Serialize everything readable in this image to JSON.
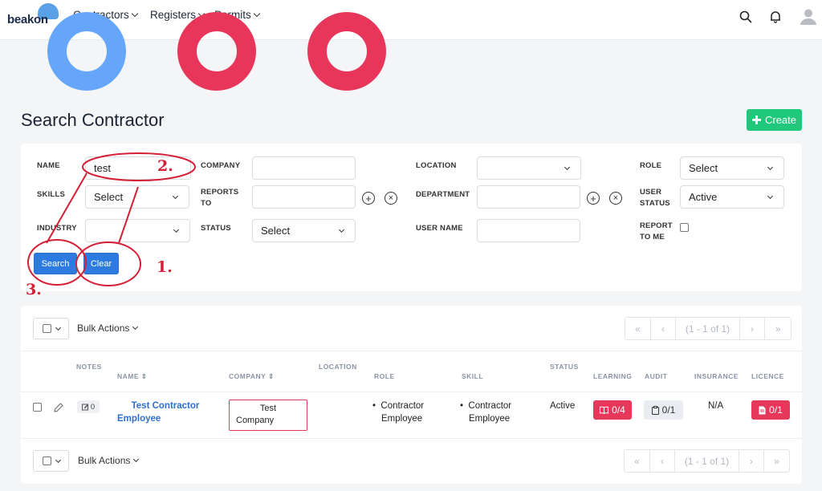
{
  "brand": {
    "logo_text": "beakon"
  },
  "nav": {
    "items": [
      {
        "label": "Contractors"
      },
      {
        "label": "Registers"
      },
      {
        "label": "Permits"
      }
    ]
  },
  "colors": {
    "ring1": "#66a6fa",
    "ring2": "#e8365a",
    "ring3": "#e8365a",
    "create_green": "#1fc87a",
    "primary_blue": "#2d7be0",
    "annotation_red": "#d41f36"
  },
  "page": {
    "title": "Search Contractor",
    "create_label": "Create"
  },
  "filters": {
    "name": {
      "label": "NAME",
      "value": "test"
    },
    "company": {
      "label": "COMPANY",
      "value": ""
    },
    "location": {
      "label": "LOCATION",
      "value": ""
    },
    "role": {
      "label": "ROLE",
      "value": "Select"
    },
    "skills": {
      "label": "SKILLS",
      "value": "Select"
    },
    "reports_to": {
      "label_1": "REPORTS",
      "label_2": "TO",
      "value": ""
    },
    "department": {
      "label": "DEPARTMENT",
      "value": ""
    },
    "user_status": {
      "label_1": "USER",
      "label_2": "STATUS",
      "value": "Active"
    },
    "industry": {
      "label": "INDUSTRY",
      "value": ""
    },
    "status": {
      "label": "STATUS",
      "value": "Select"
    },
    "user_name": {
      "label": "USER NAME",
      "value": ""
    },
    "report_to_me": {
      "label_1": "REPORT",
      "label_2": "TO ME",
      "checked": false
    },
    "search_label": "Search",
    "clear_label": "Clear"
  },
  "annotations": {
    "a1": "1.",
    "a2": "2.",
    "a3": "3."
  },
  "table": {
    "bulk_label": "Bulk Actions",
    "pager": {
      "first": "«",
      "prev": "‹",
      "info": "(1 - 1 of 1)",
      "next": "›",
      "last": "»"
    },
    "headers": {
      "notes": "NOTES",
      "name": "NAME",
      "company": "COMPANY",
      "location": "LOCATION",
      "role": "ROLE",
      "skill": "SKILL",
      "status": "STATUS",
      "learning": "LEARNING",
      "audit": "AUDIT",
      "insurance": "INSURANCE",
      "licence": "LICENCE"
    },
    "rows": [
      {
        "notes_count": "0",
        "name_1": "Test Contractor",
        "name_2": "Employee",
        "company_1": "Test",
        "company_2": "Company",
        "location": "",
        "role_1": "Contractor",
        "role_2": "Employee",
        "skill_1": "Contractor",
        "skill_2": "Employee",
        "status": "Active",
        "learning": "0/4",
        "audit": "0/1",
        "insurance": "N/A",
        "licence": "0/1"
      }
    ]
  }
}
